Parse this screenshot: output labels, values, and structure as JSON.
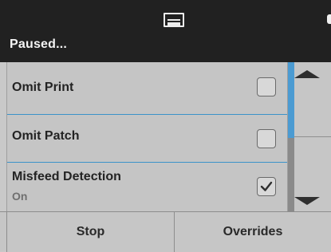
{
  "header": {
    "icon": "scanner-icon",
    "status_text": "Paused..."
  },
  "list": {
    "items": [
      {
        "label": "Omit Print",
        "checked": false
      },
      {
        "label": "Omit Patch",
        "checked": false
      },
      {
        "label": "Misfeed Detection",
        "sublabel": "On",
        "checked": true
      }
    ]
  },
  "scroll": {
    "up_icon": "arrow-up-icon",
    "down_icon": "arrow-down-icon",
    "position_fraction": 0.0
  },
  "footer": {
    "stop_label": "Stop",
    "overrides_label": "Overrides"
  },
  "colors": {
    "header_bg": "#212121",
    "accent": "#4b9bd2",
    "panel_bg": "#c6c6c6"
  }
}
